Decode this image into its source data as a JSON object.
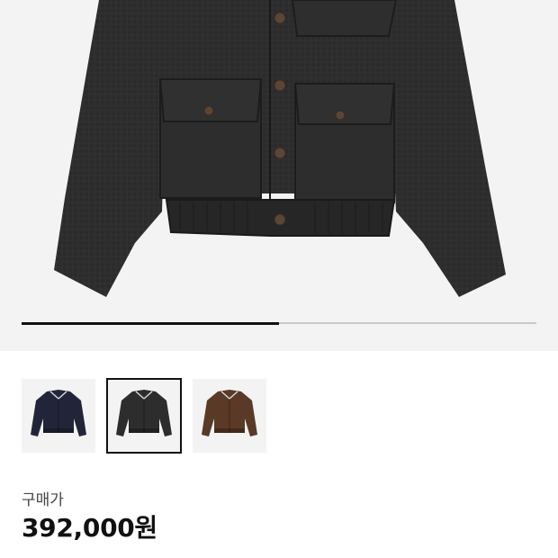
{
  "gallery": {
    "progress_fraction": 0.5,
    "main_image_icon": "jacket-image"
  },
  "thumbnails": [
    {
      "name": "thumbnail-navy",
      "color": "#22253a",
      "selected": false
    },
    {
      "name": "thumbnail-charcoal",
      "color": "#2d2d2d",
      "selected": true
    },
    {
      "name": "thumbnail-brown",
      "color": "#5a3a26",
      "selected": false
    }
  ],
  "price": {
    "label": "구매가",
    "value": "392,000원"
  },
  "colors": {
    "jacket_main": "#2b2b2b",
    "background": "#f3f3f3",
    "accent": "#111111"
  }
}
